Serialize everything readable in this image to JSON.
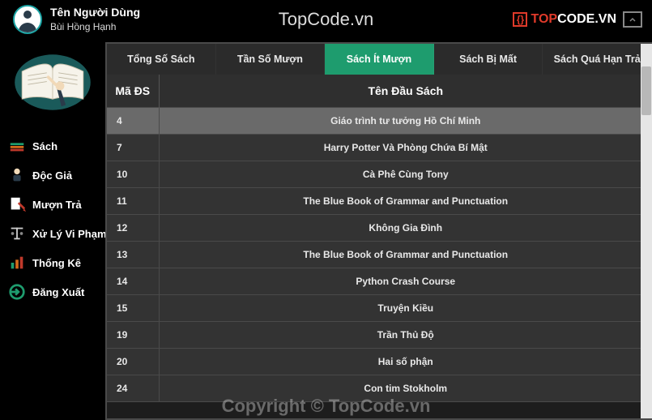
{
  "header": {
    "user_title": "Tên Người Dùng",
    "user_name": "Bùi Hồng Hạnh",
    "center_title": "TopCode.vn",
    "brand_top": "TOP",
    "brand_code": "CODE",
    "brand_domain": ".VN"
  },
  "sidebar": {
    "items": [
      {
        "label": "Sách"
      },
      {
        "label": "Độc Giả"
      },
      {
        "label": "Mượn Trả"
      },
      {
        "label": "Xử Lý Vi Phạm"
      },
      {
        "label": "Thống Kê"
      },
      {
        "label": "Đăng Xuất"
      }
    ]
  },
  "tabs": [
    {
      "label": "Tổng Số Sách",
      "active": false
    },
    {
      "label": "Tần Số Mượn",
      "active": false
    },
    {
      "label": "Sách Ít Mượn",
      "active": true
    },
    {
      "label": "Sách Bị Mất",
      "active": false
    },
    {
      "label": "Sách Quá Hạn Trả",
      "active": false
    }
  ],
  "table": {
    "headers": {
      "id": "Mã ĐS",
      "title": "Tên Đầu Sách"
    },
    "rows": [
      {
        "id": "4",
        "title": "Giáo trình tư tưởng Hồ Chí Minh"
      },
      {
        "id": "7",
        "title": "Harry Potter Và Phòng Chứa Bí Mật"
      },
      {
        "id": "10",
        "title": "Cà Phê Cùng Tony"
      },
      {
        "id": "11",
        "title": "The Blue Book of Grammar and Punctuation"
      },
      {
        "id": "12",
        "title": "Không Gia Đình"
      },
      {
        "id": "13",
        "title": "The Blue Book of Grammar and Punctuation"
      },
      {
        "id": "14",
        "title": "Python Crash Course"
      },
      {
        "id": "15",
        "title": "Truyện Kiều"
      },
      {
        "id": "19",
        "title": "Trần Thủ Độ"
      },
      {
        "id": "20",
        "title": "Hai số phận"
      },
      {
        "id": "24",
        "title": "Con tim Stokholm"
      }
    ]
  },
  "watermark": "Copyright © TopCode.vn"
}
